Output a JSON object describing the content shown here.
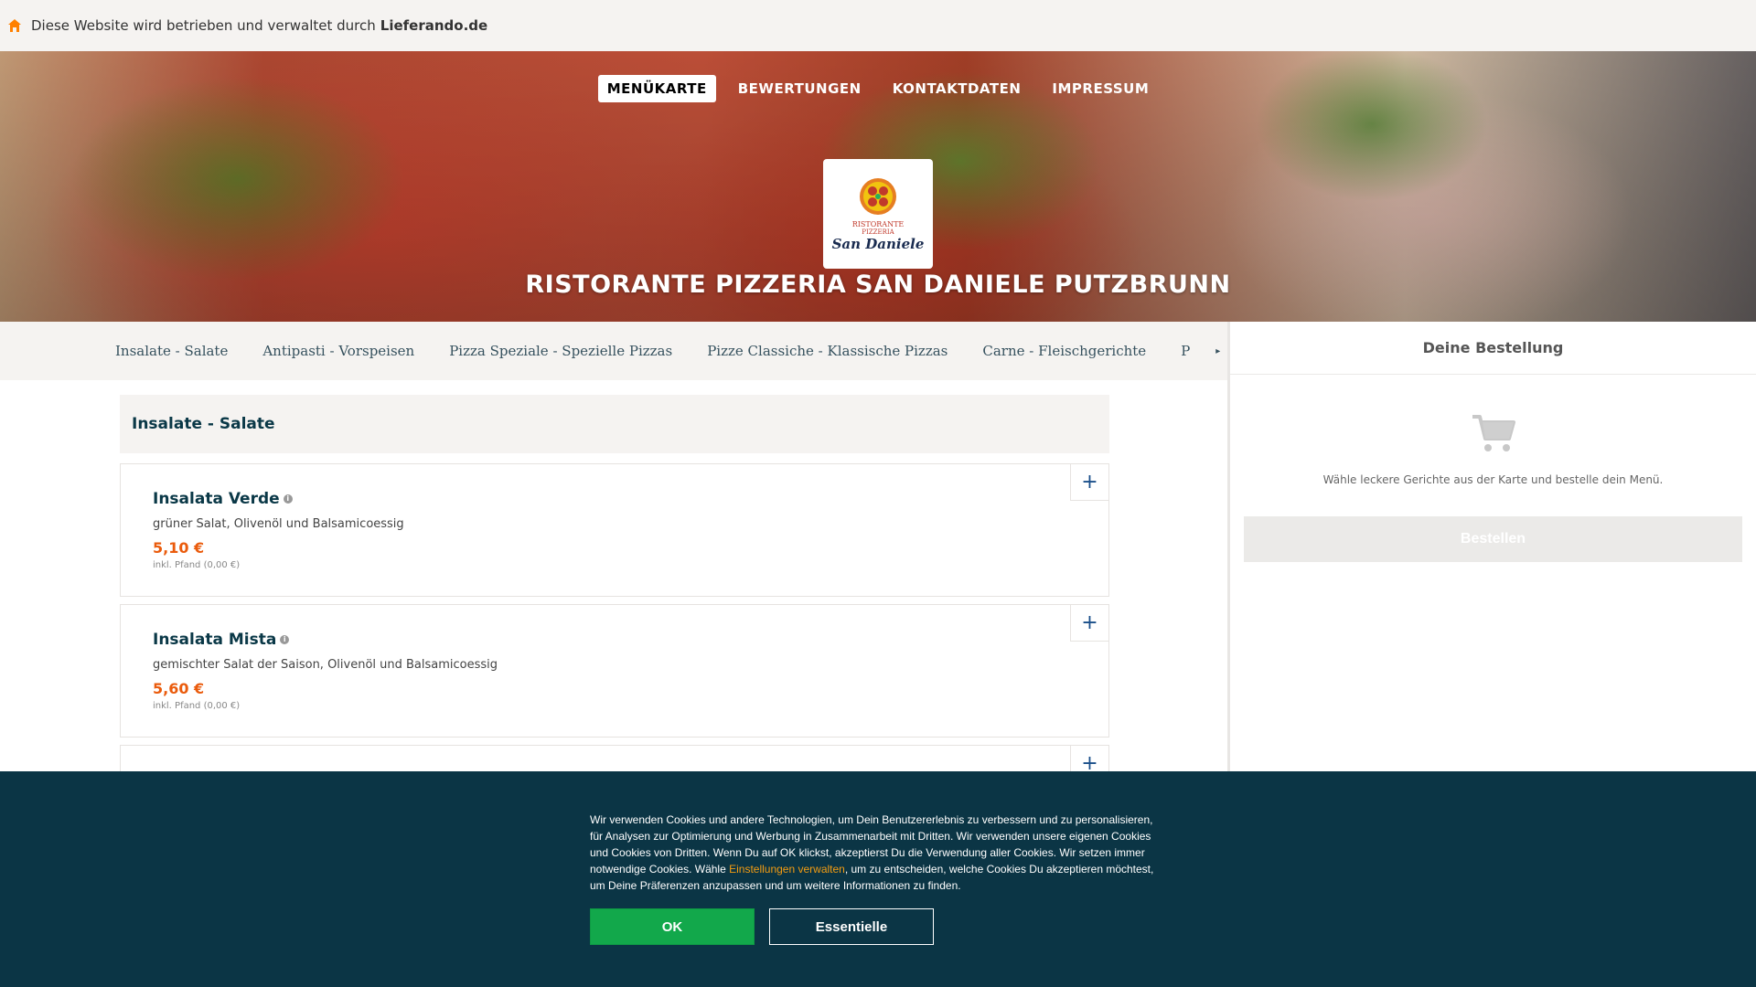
{
  "topbar": {
    "text": "Diese Website wird betrieben und verwaltet durch",
    "brand": "Lieferando.de"
  },
  "nav": {
    "items": [
      "MENÜKARTE",
      "BEWERTUNGEN",
      "KONTAKTDATEN",
      "IMPRESSUM"
    ]
  },
  "logo": {
    "line1": "RISTORANTE",
    "line2": "PIZZERIA",
    "line3": "San Daniele"
  },
  "restaurant": {
    "title": "RISTORANTE PIZZERIA SAN DANIELE PUTZBRUNN"
  },
  "categories": {
    "items": [
      "Insalate - Salate",
      "Antipasti - Vorspeisen",
      "Pizza Speziale - Spezielle Pizzas",
      "Pizze Classiche - Klassische Pizzas",
      "Carne - Fleischgerichte",
      "P"
    ],
    "more_icon": "chevron-right-icon"
  },
  "menu": {
    "section_title": "Insalate - Salate",
    "dishes": [
      {
        "name": "Insalata Verde",
        "description": "grüner Salat, Olivenöl und Balsamicoessig",
        "price": "5,10 €",
        "deposit": "inkl. Pfand (0,00 €)"
      },
      {
        "name": "Insalata Mista",
        "description": "gemischter Salat der Saison, Olivenöl und Balsamicoessig",
        "price": "5,60 €",
        "deposit": "inkl. Pfand (0,00 €)"
      }
    ],
    "add_label": "+"
  },
  "basket": {
    "title": "Deine Bestellung",
    "hint": "Wähle leckere Gerichte aus der Karte und bestelle dein Menü.",
    "order_label": "Bestellen"
  },
  "cookie": {
    "text_before": "Wir verwenden Cookies und andere Technologien, um Dein Benutzererlebnis zu verbessern und zu personalisieren, für Analysen zur Optimierung und Werbung in Zusammenarbeit mit Dritten. Wir verwenden unsere eigenen Cookies und Cookies von Dritten. Wenn Du auf OK klickst, akzeptierst Du die Verwendung aller Cookies. Wir setzen immer notwendige Cookies. Wähle ",
    "link": "Einstellungen verwalten",
    "text_after": ", um zu entscheiden, welche Cookies Du akzeptieren möchtest, um Deine Präferenzen anzupassen und um weitere Informationen zu finden.",
    "ok_label": "OK",
    "essential_label": "Essentielle"
  },
  "colors": {
    "accent_orange": "#ea5b0c",
    "navy": "#0a3847",
    "cookie_bg": "#0b3545",
    "ok_green": "#12a84b"
  }
}
